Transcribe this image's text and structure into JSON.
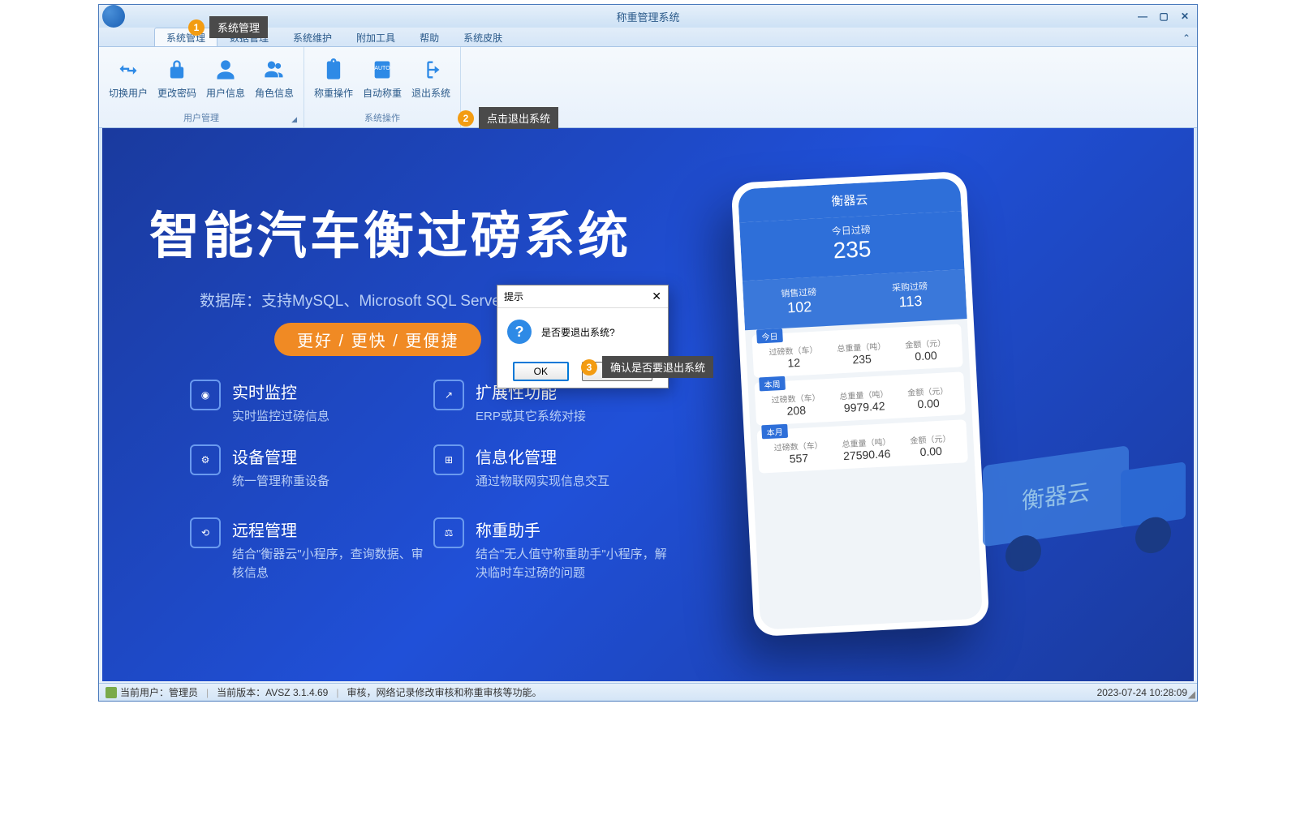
{
  "window": {
    "title": "称重管理系统"
  },
  "ribbon": {
    "tabs": [
      "系统管理",
      "数据管理",
      "系统维护",
      "附加工具",
      "帮助",
      "系统皮肤"
    ],
    "group1": {
      "label": "用户管理",
      "items": [
        "切换用户",
        "更改密码",
        "用户信息",
        "角色信息"
      ]
    },
    "group2": {
      "label": "系统操作",
      "items": [
        "称重操作",
        "自动称重",
        "退出系统"
      ]
    }
  },
  "hero": {
    "title": "智能汽车衡过磅系统",
    "sub": "数据库：支持MySQL、Microsoft SQL Server",
    "badge": "更好 / 更快 / 更便捷"
  },
  "features": [
    {
      "title": "实时监控",
      "desc": "实时监控过磅信息"
    },
    {
      "title": "设备管理",
      "desc": "统一管理称重设备"
    },
    {
      "title": "远程管理",
      "desc": "结合\"衡器云\"小程序，查询数据、审核信息"
    },
    {
      "title": "扩展性功能",
      "desc": "ERP或其它系统对接"
    },
    {
      "title": "信息化管理",
      "desc": "通过物联网实现信息交互"
    },
    {
      "title": "称重助手",
      "desc": "结合\"无人值守称重助手\"小程序，解决临时车过磅的问题"
    }
  ],
  "phone": {
    "app_name": "衡器云",
    "today_label": "今日过磅",
    "today_val": "235",
    "sales_label": "销售过磅",
    "sales_val": "102",
    "purchase_label": "采购过磅",
    "purchase_val": "113",
    "cards": [
      {
        "tag": "今日",
        "cols": [
          {
            "h": "过磅数（车）",
            "v": "12"
          },
          {
            "h": "总重量（吨）",
            "v": "235"
          },
          {
            "h": "金额（元）",
            "v": "0.00"
          }
        ]
      },
      {
        "tag": "本周",
        "cols": [
          {
            "h": "过磅数（车）",
            "v": "208"
          },
          {
            "h": "总重量（吨）",
            "v": "9979.42"
          },
          {
            "h": "金额（元）",
            "v": "0.00"
          }
        ]
      },
      {
        "tag": "本月",
        "cols": [
          {
            "h": "过磅数（车）",
            "v": "557"
          },
          {
            "h": "总重量（吨）",
            "v": "27590.46"
          },
          {
            "h": "金额（元）",
            "v": "0.00"
          }
        ]
      }
    ],
    "truck_label": "衡器云"
  },
  "dialog": {
    "title": "提示",
    "message": "是否要退出系统?",
    "ok": "OK",
    "cancel": "Cancel"
  },
  "status": {
    "user_label": "当前用户：",
    "user_value": "管理员",
    "version_label": "当前版本：",
    "version_value": "AVSZ 3.1.4.69",
    "scroll_text": "审核，网络记录修改审核和称重审核等功能。",
    "datetime": "2023-07-24 10:28:09"
  },
  "annotations": [
    {
      "num": "1",
      "text": "系统管理"
    },
    {
      "num": "2",
      "text": "点击退出系统"
    },
    {
      "num": "3",
      "text": "确认是否要退出系统"
    }
  ]
}
